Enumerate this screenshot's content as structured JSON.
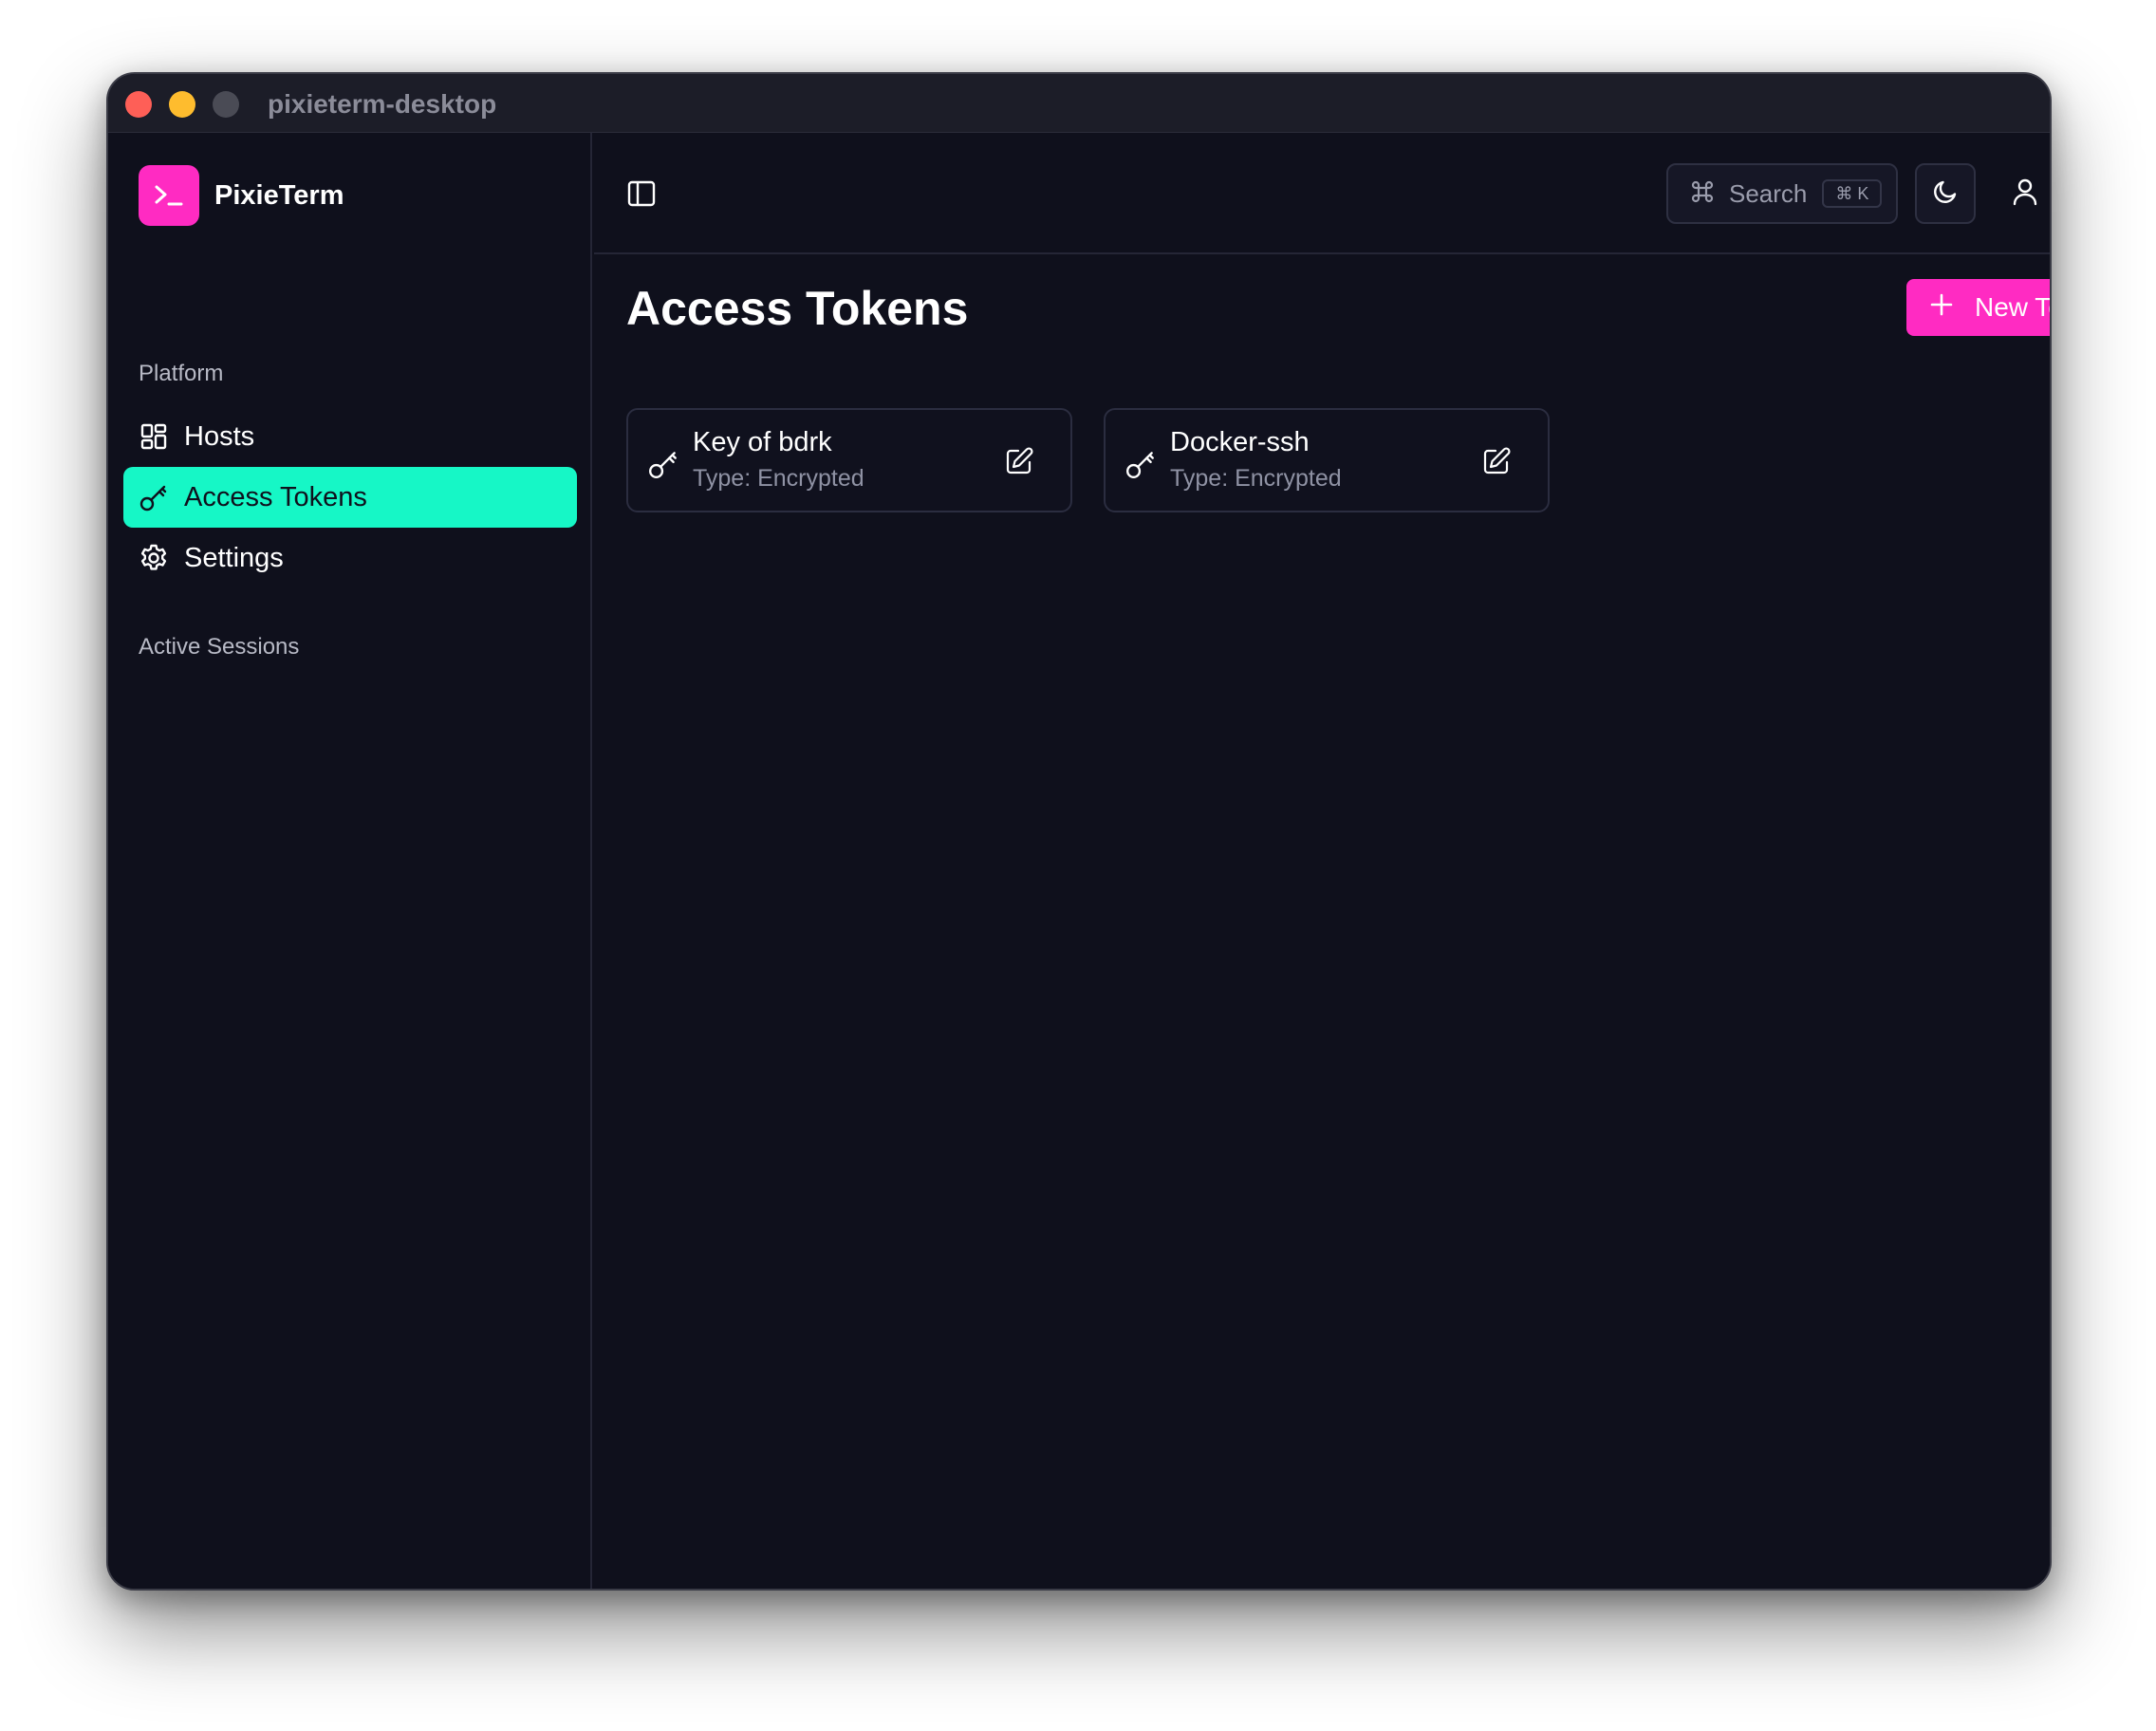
{
  "window": {
    "title": "pixieterm-desktop"
  },
  "brand": {
    "name": "PixieTerm",
    "logo_icon": "terminal-prompt-icon",
    "accent": "#ff2bc2"
  },
  "sidebar": {
    "sections": [
      {
        "label": "Platform"
      },
      {
        "label": "Active Sessions"
      }
    ],
    "items": [
      {
        "label": "Hosts",
        "icon": "grid-icon",
        "active": false
      },
      {
        "label": "Access Tokens",
        "icon": "key-icon",
        "active": true
      },
      {
        "label": "Settings",
        "icon": "gear-icon",
        "active": false
      }
    ],
    "active_color": "#16f7c6"
  },
  "topbar": {
    "search": {
      "label": "Search",
      "shortcut": "⌘ K"
    },
    "theme_icon": "moon-icon",
    "user_icon": "user-icon",
    "sidebar_toggle_icon": "sidebar-panel-icon"
  },
  "page": {
    "title": "Access Tokens",
    "new_button": "New Token"
  },
  "tokens": [
    {
      "name": "Key of bdrk",
      "type": "Type: Encrypted"
    },
    {
      "name": "Docker-ssh",
      "type": "Type: Encrypted"
    }
  ]
}
